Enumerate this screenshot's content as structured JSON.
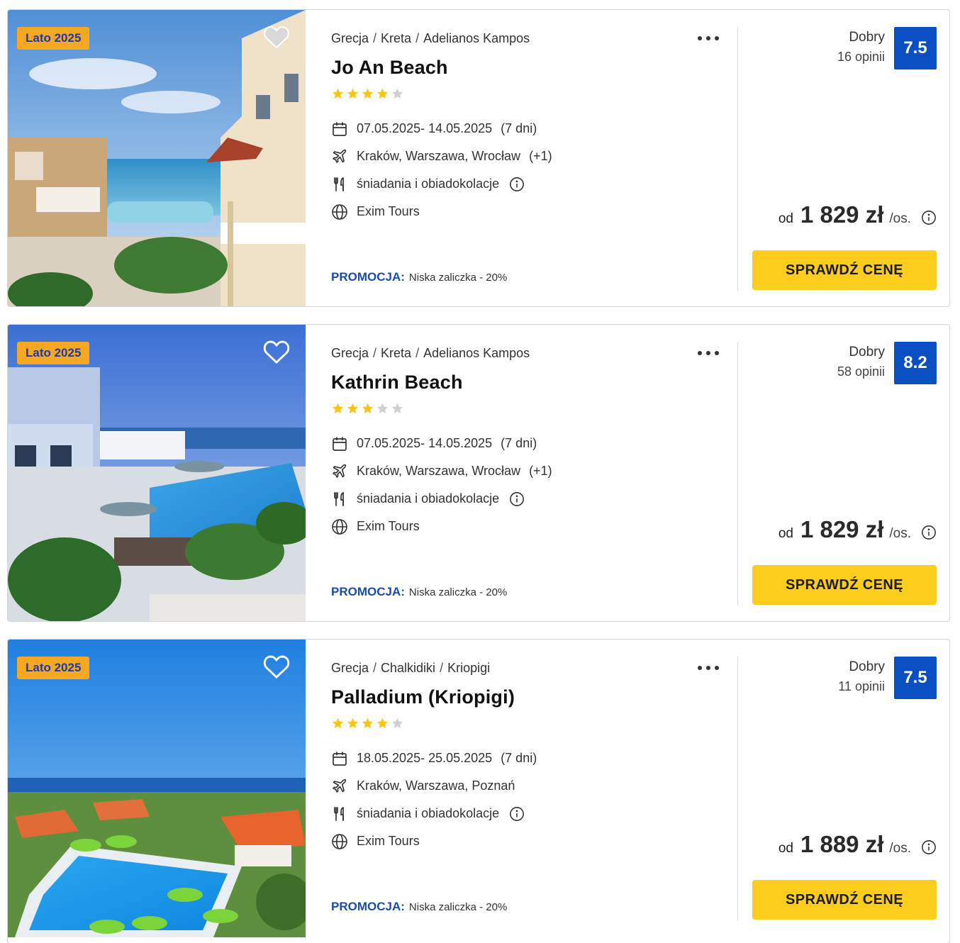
{
  "colors": {
    "badge_bg": "#f7a823",
    "badge_text": "#1f3b9c",
    "score_bg": "#0a4fc2",
    "button_bg": "#fdcd1e",
    "promo_label": "#1a4bb0",
    "star_filled": "#f8c51c",
    "star_empty": "#d0d0d0"
  },
  "offers": [
    {
      "badge": "Lato 2025",
      "photo_icon": "hotel-photo-image",
      "heart_state": "filled-grey",
      "crumbs": [
        "Grecja",
        "Kreta",
        "Adelianos Kampos"
      ],
      "sep": "/",
      "title": "Jo An Beach",
      "stars": 4,
      "dates": "07.05.2025- 14.05.2025",
      "duration": "(7 dni)",
      "departure": "Kraków, Warszawa, Wrocław",
      "departure_extra": "(+1)",
      "board": "śniadania i obiadokolacje",
      "operator": "Exim Tours",
      "promo_label": "PROMOCJA:",
      "promo_text": "Niska zaliczka - 20%",
      "rating_word": "Dobry",
      "rating_count": "16 opinii",
      "score": "7.5",
      "price_prefix": "od",
      "price": "1 829 zł",
      "price_suffix": "/os.",
      "button": "SPRAWDŹ CENĘ"
    },
    {
      "badge": "Lato 2025",
      "photo_icon": "hotel-photo-image",
      "heart_state": "outline-white",
      "crumbs": [
        "Grecja",
        "Kreta",
        "Adelianos Kampos"
      ],
      "sep": "/",
      "title": "Kathrin Beach",
      "stars": 3,
      "dates": "07.05.2025- 14.05.2025",
      "duration": "(7 dni)",
      "departure": "Kraków, Warszawa, Wrocław",
      "departure_extra": "(+1)",
      "board": "śniadania i obiadokolacje",
      "operator": "Exim Tours",
      "promo_label": "PROMOCJA:",
      "promo_text": "Niska zaliczka - 20%",
      "rating_word": "Dobry",
      "rating_count": "58 opinii",
      "score": "8.2",
      "price_prefix": "od",
      "price": "1 829 zł",
      "price_suffix": "/os.",
      "button": "SPRAWDŹ CENĘ"
    },
    {
      "badge": "Lato 2025",
      "photo_icon": "hotel-photo-image",
      "heart_state": "outline-white",
      "crumbs": [
        "Grecja",
        "Chalkidiki",
        "Kriopigi"
      ],
      "sep": "/",
      "title": "Palladium (Kriopigi)",
      "stars": 4,
      "dates": "18.05.2025- 25.05.2025",
      "duration": "(7 dni)",
      "departure": "Kraków, Warszawa, Poznań",
      "departure_extra": "",
      "board": "śniadania i obiadokolacje",
      "operator": "Exim Tours",
      "promo_label": "PROMOCJA:",
      "promo_text": "Niska zaliczka - 20%",
      "rating_word": "Dobry",
      "rating_count": "11 opinii",
      "score": "7.5",
      "price_prefix": "od",
      "price": "1 889 zł",
      "price_suffix": "/os.",
      "button": "SPRAWDŹ CENĘ"
    }
  ]
}
